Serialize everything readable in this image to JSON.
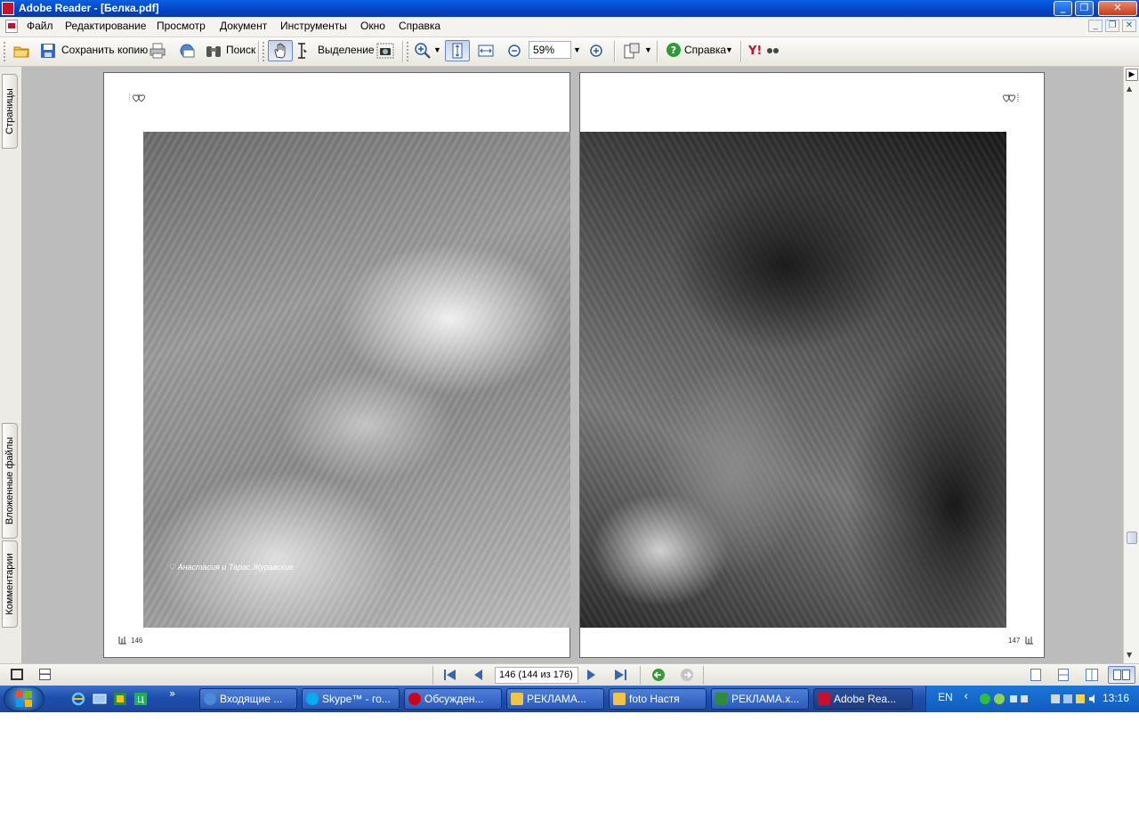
{
  "window": {
    "title": "Adobe Reader - [Белка.pdf]"
  },
  "menu": [
    "Файл",
    "Редактирование",
    "Просмотр",
    "Документ",
    "Инструменты",
    "Окно",
    "Справка"
  ],
  "toolbar": {
    "save_copy": "Сохранить копию",
    "search": "Поиск",
    "select": "Выделение",
    "zoom": "59%",
    "help": "Справка"
  },
  "sidebar_tabs": [
    "Страницы",
    "Вложенные файлы",
    "Комментарии"
  ],
  "document": {
    "left_page_number": "146",
    "right_page_number": "147",
    "caption": "Анастасия и Тарас Журавские"
  },
  "status": {
    "page_field": "146  (144 из 176)"
  },
  "taskbar": {
    "tasks": [
      "Входящие ...",
      "Skype™ - го...",
      "Обсужден...",
      "РЕКЛАМА...",
      "foto Настя",
      "РЕКЛАМА.х...",
      "Adobe Rea..."
    ],
    "language": "EN",
    "clock": "13:16"
  }
}
